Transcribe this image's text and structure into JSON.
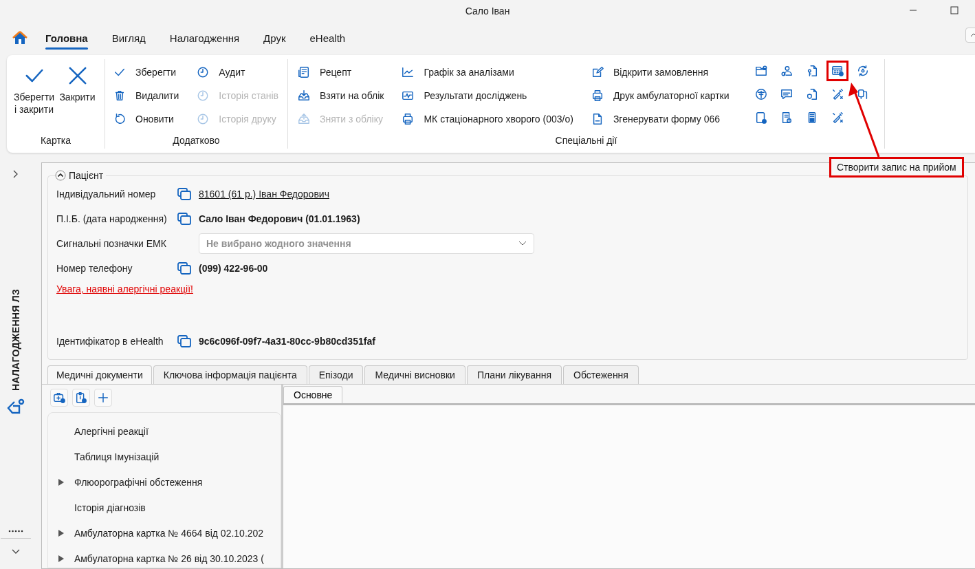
{
  "window": {
    "title": "Сало Іван"
  },
  "menu_tabs": [
    {
      "label": "Головна",
      "selected": true
    },
    {
      "label": "Вигляд",
      "selected": false
    },
    {
      "label": "Налагодження",
      "selected": false
    },
    {
      "label": "Друк",
      "selected": false
    },
    {
      "label": "eHealth",
      "selected": false
    }
  ],
  "ribbon": {
    "groups": [
      {
        "kind": "large",
        "label": "Картка",
        "items": [
          {
            "label": "Зберегти і закрити",
            "disabled": false
          },
          {
            "label": "Закрити",
            "disabled": false
          }
        ]
      },
      {
        "kind": "small",
        "label": "Додатково",
        "items": [
          {
            "label": "Зберегти",
            "disabled": false
          },
          {
            "label": "Видалити",
            "disabled": false
          },
          {
            "label": "Оновити",
            "disabled": false
          },
          {
            "label": "Аудит",
            "disabled": false
          },
          {
            "label": "Історія станів",
            "disabled": true
          },
          {
            "label": "Історія друку",
            "disabled": true
          }
        ]
      },
      {
        "kind": "special",
        "label": "Спеціальні дії",
        "items": [
          {
            "label": "Рецепт",
            "disabled": false
          },
          {
            "label": "Взяти на облік",
            "disabled": false
          },
          {
            "label": "Зняти з обліку",
            "disabled": true
          },
          {
            "label": "Графік за аналізами",
            "disabled": false
          },
          {
            "label": "Результати досліджень",
            "disabled": false
          },
          {
            "label": "МК стаціонарного хворого (003/о)",
            "disabled": false
          },
          {
            "label": "Відкрити замовлення",
            "disabled": false
          },
          {
            "label": "Друк амбулаторної картки",
            "disabled": false
          },
          {
            "label": "Згенерувати форму 066",
            "disabled": false
          }
        ],
        "icon_buttons": [
          {
            "highlighted": false
          },
          {
            "highlighted": false
          },
          {
            "highlighted": false
          },
          {
            "highlighted": true
          },
          {
            "highlighted": false
          },
          {
            "highlighted": false
          },
          {
            "highlighted": false
          },
          {
            "highlighted": false
          },
          {
            "highlighted": false
          },
          {
            "highlighted": false
          },
          {
            "highlighted": false
          },
          {
            "highlighted": false
          },
          {
            "highlighted": false
          },
          {
            "highlighted": false
          }
        ]
      }
    ]
  },
  "tooltip": {
    "text": "Створити запис на прийом"
  },
  "sidebar": {
    "title": "НАЛАГОДЖЕННЯ ЛЗ"
  },
  "patient": {
    "title": "Пацієнт",
    "expanded": true,
    "fields": [
      {
        "label": "Індивідуальний номер",
        "kind": "link",
        "value": "81601 (61 р.) Іван Федорович"
      },
      {
        "label": "П.І.Б. (дата народження)",
        "kind": "bold",
        "value": "Сало Іван Федорович (01.01.1963)"
      },
      {
        "label": "Сигнальні позначки ЕМК",
        "kind": "dropdown",
        "placeholder": "Не вибрано жодного значення"
      },
      {
        "label": "Номер телефону",
        "kind": "bold",
        "value": "(099) 422-96-00"
      }
    ],
    "warning": "Увага, наявні алергічні реакції!",
    "footer_fields": [
      {
        "label": "Ідентифікатор в eHealth",
        "kind": "bold",
        "value": "9c6c096f-09f7-4a31-80cc-9b80cd351faf"
      }
    ]
  },
  "doc_tabs": [
    {
      "label": "Медичні документи",
      "selected": true
    },
    {
      "label": "Ключова інформація пацієнта",
      "selected": false
    },
    {
      "label": "Епізоди",
      "selected": false
    },
    {
      "label": "Медичні висновки",
      "selected": false
    },
    {
      "label": "Плани лікування",
      "selected": false
    },
    {
      "label": "Обстеження",
      "selected": false
    }
  ],
  "tree": [
    {
      "label": "Алергічні реакції",
      "kind": "leaf"
    },
    {
      "label": "Таблиця Імунізацій",
      "kind": "leaf"
    },
    {
      "label": "Флюорографічні обстеження",
      "kind": "group"
    },
    {
      "label": "Історія діагнозів",
      "kind": "leaf"
    },
    {
      "label": "Амбулаторна картка № 4664 від 02.10.202",
      "kind": "group"
    },
    {
      "label": "Амбулаторна картка № 26 від 30.10.2023 (",
      "kind": "group"
    }
  ],
  "detail_tabs": [
    {
      "label": "Основне",
      "selected": true
    }
  ]
}
